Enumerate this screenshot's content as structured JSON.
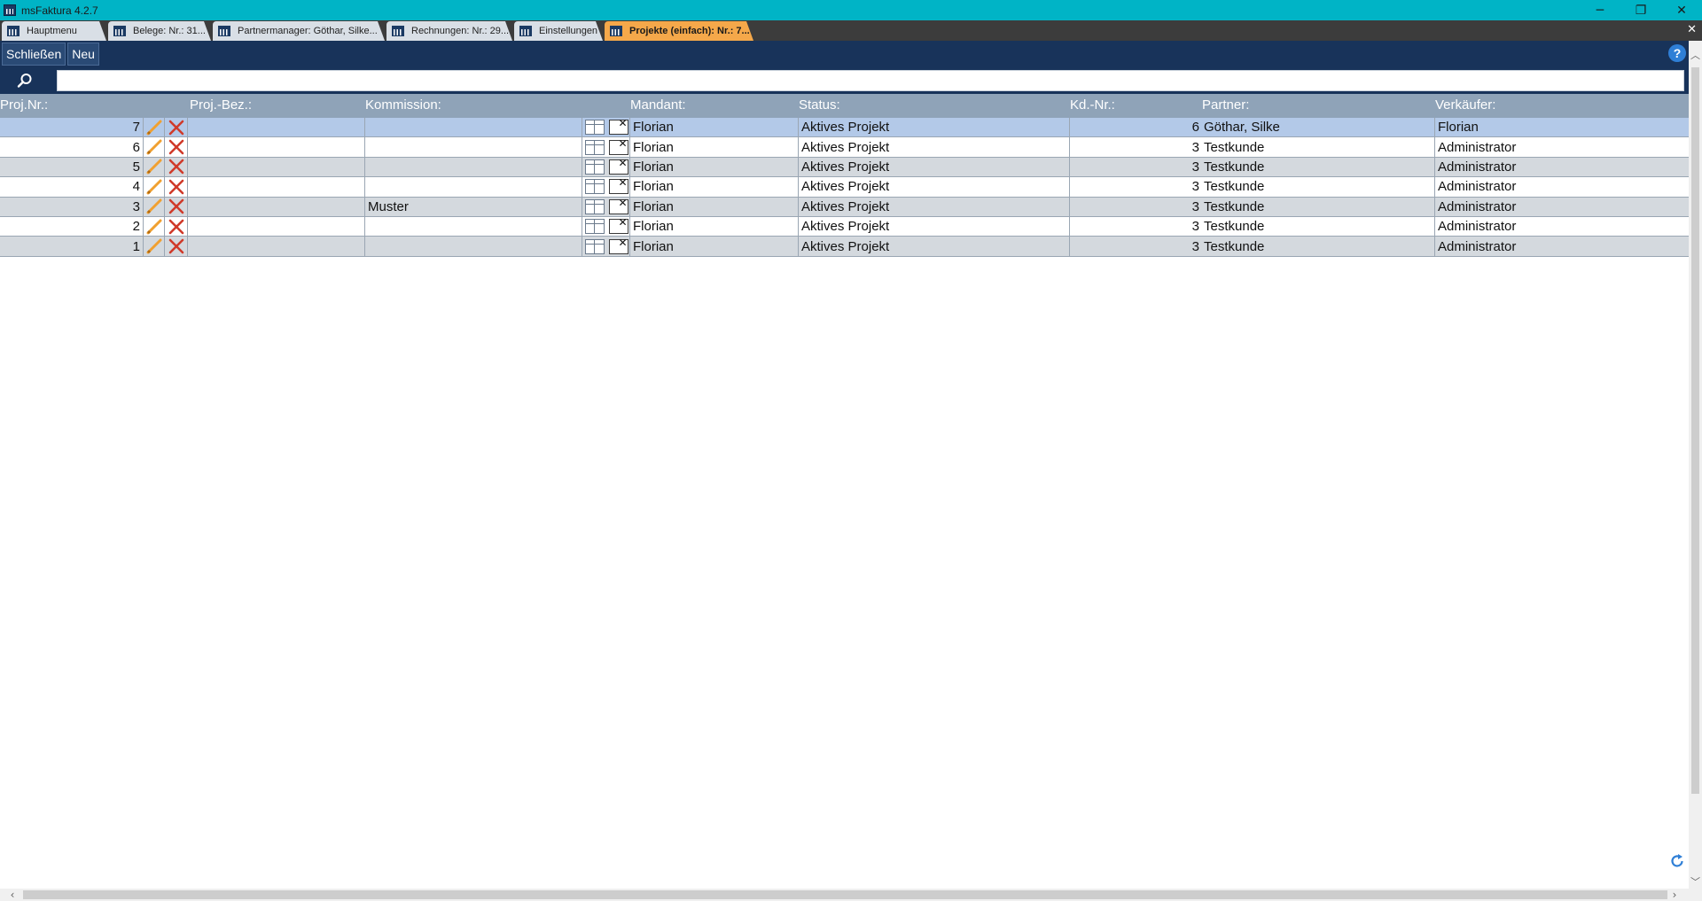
{
  "window": {
    "title": "msFaktura 4.2.7",
    "controls": {
      "minimize": "─",
      "restore": "❐",
      "close": "✕"
    }
  },
  "tabs": [
    {
      "label": "Hauptmenu",
      "active": false
    },
    {
      "label": "Belege: Nr.: 31...",
      "active": false
    },
    {
      "label": "Partnermanager: Göthar, Silke...",
      "active": false
    },
    {
      "label": "Rechnungen: Nr.: 29...",
      "active": false
    },
    {
      "label": "Einstellungen",
      "active": false
    },
    {
      "label": "Projekte (einfach): Nr.: 7...",
      "active": true
    }
  ],
  "tabbar_close": "✕",
  "toolbar": {
    "close_label": "Schließen",
    "new_label": "Neu",
    "help": "?"
  },
  "search": {
    "value": "",
    "placeholder": ""
  },
  "table": {
    "headers": {
      "nr": "Proj.Nr.:",
      "bez": "Proj.-Bez.:",
      "kommission": "Kommission:",
      "mandant": "Mandant:",
      "status": "Status:",
      "kdnr": "Kd.-Nr.:",
      "partner": "Partner:",
      "verkaeufer": "Verkäufer:"
    },
    "rows": [
      {
        "nr": "7",
        "bez": "",
        "kommission": "",
        "mandant": "Florian",
        "status": "Aktives Projekt",
        "kdnr": "6",
        "partner": "Göthar, Silke",
        "verkaeufer": "Florian",
        "selected": true
      },
      {
        "nr": "6",
        "bez": "",
        "kommission": "",
        "mandant": "Florian",
        "status": "Aktives Projekt",
        "kdnr": "3",
        "partner": "Testkunde",
        "verkaeufer": "Administrator"
      },
      {
        "nr": "5",
        "bez": "",
        "kommission": "",
        "mandant": "Florian",
        "status": "Aktives Projekt",
        "kdnr": "3",
        "partner": "Testkunde",
        "verkaeufer": "Administrator"
      },
      {
        "nr": "4",
        "bez": "",
        "kommission": "",
        "mandant": "Florian",
        "status": "Aktives Projekt",
        "kdnr": "3",
        "partner": "Testkunde",
        "verkaeufer": "Administrator"
      },
      {
        "nr": "3",
        "bez": "",
        "kommission": "Muster",
        "mandant": "Florian",
        "status": "Aktives Projekt",
        "kdnr": "3",
        "partner": "Testkunde",
        "verkaeufer": "Administrator"
      },
      {
        "nr": "2",
        "bez": "",
        "kommission": "",
        "mandant": "Florian",
        "status": "Aktives Projekt",
        "kdnr": "3",
        "partner": "Testkunde",
        "verkaeufer": "Administrator"
      },
      {
        "nr": "1",
        "bez": "",
        "kommission": "",
        "mandant": "Florian",
        "status": "Aktives Projekt",
        "kdnr": "3",
        "partner": "Testkunde",
        "verkaeufer": "Administrator"
      }
    ]
  },
  "colors": {
    "titlebar": "#00b4c6",
    "toolbar": "#18335a",
    "header": "#8fa3b8",
    "active_tab": "#f5a84a",
    "selected_row": "#b3c9e8"
  }
}
